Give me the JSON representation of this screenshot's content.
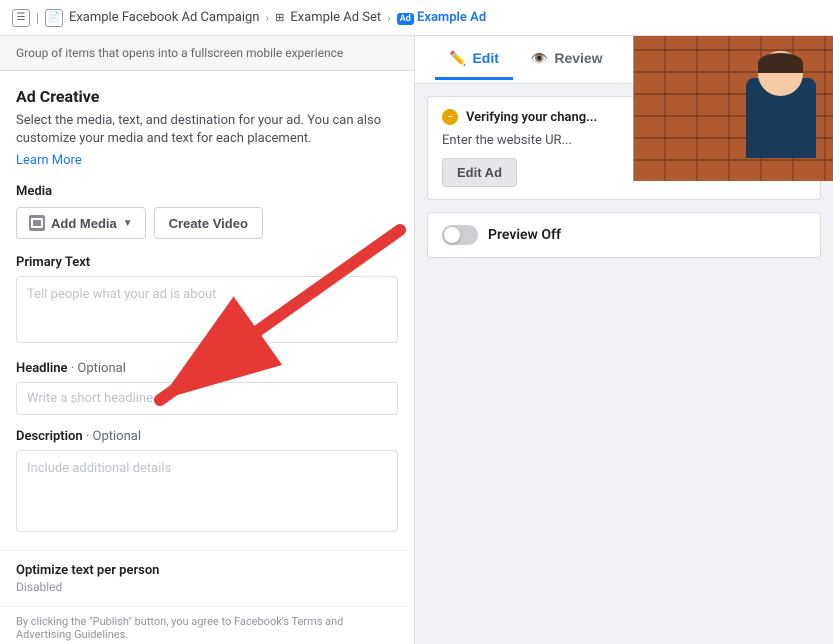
{
  "breadcrumb": {
    "items": [
      {
        "label": "Example Facebook Ad Campaign",
        "icon": "document",
        "active": false
      },
      {
        "label": "Example Ad Set",
        "icon": "grid",
        "active": false
      },
      {
        "label": "Example Ad",
        "icon": "ad",
        "active": true
      }
    ]
  },
  "top_bar": {
    "group_info": "Group of items that opens into a fullscreen mobile experience"
  },
  "tabs": {
    "edit_label": "Edit",
    "review_label": "Review"
  },
  "ad_creative": {
    "title": "Ad Creative",
    "description": "Select the media, text, and destination for your ad. You can also customize your media and text for each placement.",
    "learn_more": "Learn More"
  },
  "media": {
    "label": "Media",
    "add_media_btn": "Add Media",
    "create_video_btn": "Create Video"
  },
  "primary_text": {
    "label": "Primary Text",
    "placeholder": "Tell people what your ad is about"
  },
  "headline": {
    "label": "Headline",
    "optional_label": "· Optional",
    "placeholder": "Write a short headline"
  },
  "description": {
    "label": "Description",
    "optional_label": "· Optional",
    "placeholder": "Include additional details"
  },
  "optimize": {
    "title": "Optimize text per person",
    "value": "Disabled"
  },
  "bottom_note": "By clicking the \"Publish\" button, you agree to Facebook's Terms and Advertising Guidelines.",
  "verifying": {
    "header": "Verifying your chang...",
    "description": "Enter the website UR...",
    "edit_ad_btn": "Edit Ad"
  },
  "preview": {
    "label": "Preview Off"
  }
}
